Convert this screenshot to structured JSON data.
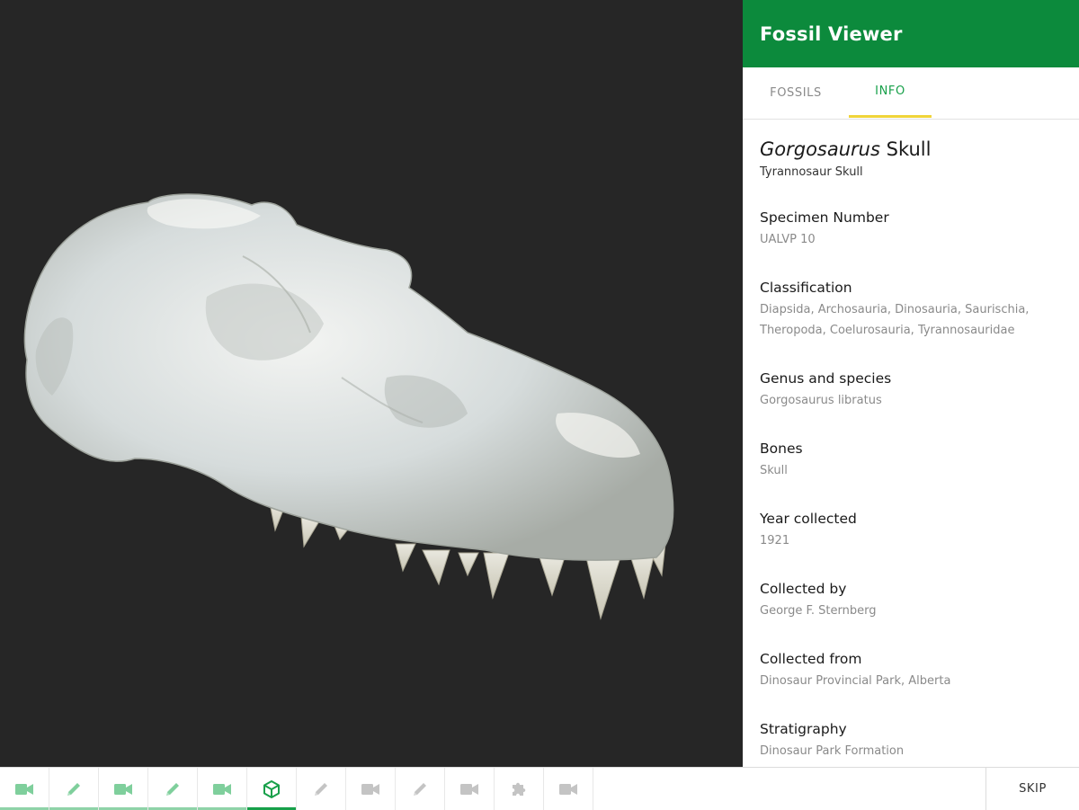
{
  "app": {
    "title": "Fossil Viewer"
  },
  "tabs": [
    {
      "label": "FOSSILS",
      "active": false
    },
    {
      "label": "INFO",
      "active": true
    }
  ],
  "fossil": {
    "genus": "Gorgosaurus",
    "title_rest": " Skull",
    "subtitle": "Tyrannosaur Skull",
    "fields": [
      {
        "label": "Specimen Number",
        "value": "UALVP 10"
      },
      {
        "label": "Classification",
        "value": "Diapsida, Archosauria, Dinosauria, Saurischia, Theropoda, Coelurosauria, Tyrannosauridae"
      },
      {
        "label": "Genus and species",
        "value": "Gorgosaurus libratus"
      },
      {
        "label": "Bones",
        "value": "Skull"
      },
      {
        "label": "Year collected",
        "value": "1921"
      },
      {
        "label": "Collected by",
        "value": "George F. Sternberg"
      },
      {
        "label": "Collected from",
        "value": "Dinosaur Provincial Park, Alberta"
      },
      {
        "label": "Stratigraphy",
        "value": "Dinosaur Park Formation"
      }
    ]
  },
  "toolbar": {
    "steps": [
      {
        "icon": "video-camera-icon",
        "state": "done"
      },
      {
        "icon": "pencil-icon",
        "state": "done"
      },
      {
        "icon": "video-camera-icon",
        "state": "done"
      },
      {
        "icon": "pencil-icon",
        "state": "done"
      },
      {
        "icon": "video-camera-icon",
        "state": "done"
      },
      {
        "icon": "cube-icon",
        "state": "active"
      },
      {
        "icon": "pencil-icon",
        "state": "pending"
      },
      {
        "icon": "video-camera-icon",
        "state": "pending"
      },
      {
        "icon": "pencil-icon",
        "state": "pending"
      },
      {
        "icon": "video-camera-icon",
        "state": "pending"
      },
      {
        "icon": "puzzle-icon",
        "state": "pending"
      },
      {
        "icon": "video-camera-icon",
        "state": "pending"
      }
    ],
    "skip_label": "SKIP"
  },
  "colors": {
    "header": "#0c8a3c",
    "accent_green": "#18a04a",
    "tab_indicator": "#f0d43a",
    "viewport_bg": "#262626",
    "done_icon": "#7fcf9c",
    "pending_icon": "#c4c4c4"
  }
}
